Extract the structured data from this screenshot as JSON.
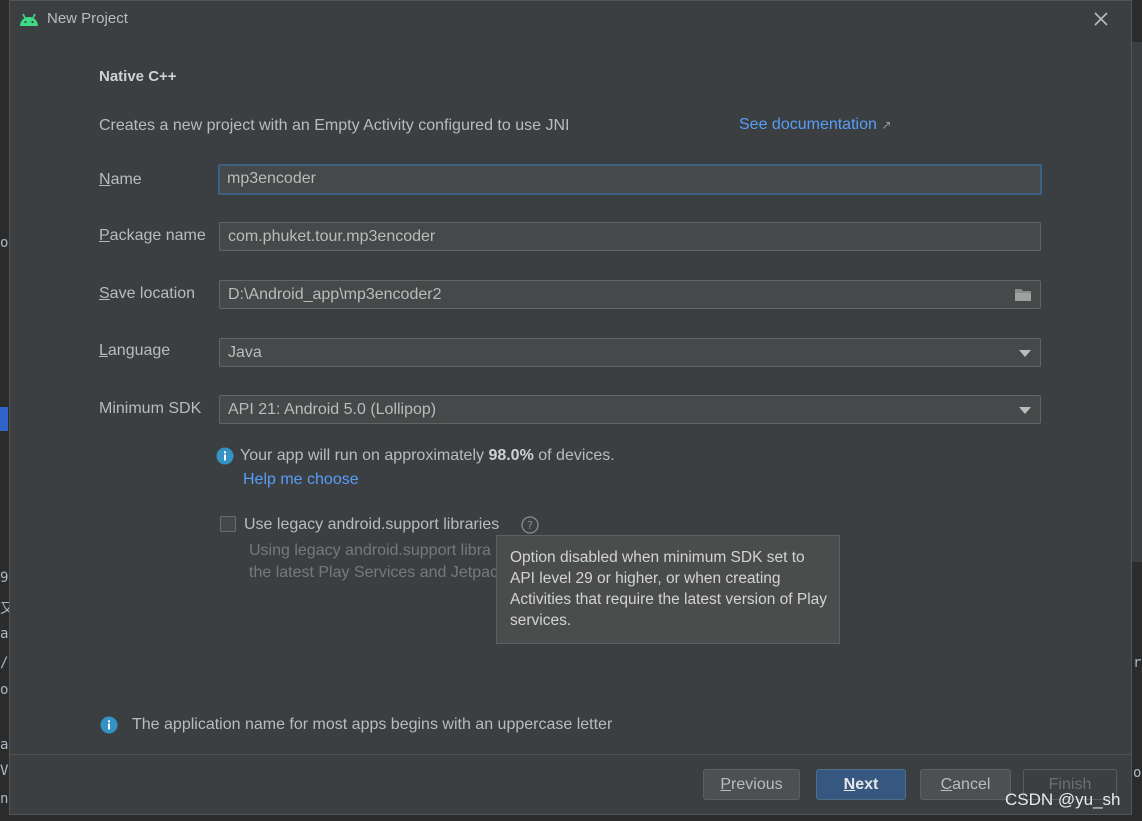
{
  "window": {
    "title": "New Project"
  },
  "template": {
    "heading": "Native C++",
    "description": "Creates a new project with an Empty Activity configured to use JNI",
    "doc_link": "See documentation",
    "doc_link_icon": "↗"
  },
  "form": {
    "name": {
      "label_mnemonic": "N",
      "label_rest": "ame",
      "value": "mp3encoder"
    },
    "package": {
      "label_mnemonic": "P",
      "label_rest": "ackage name",
      "value": "com.phuket.tour.mp3encoder"
    },
    "save_location": {
      "label_mnemonic": "S",
      "label_rest": "ave location",
      "value": "D:\\Android_app\\mp3encoder2"
    },
    "language": {
      "label_mnemonic": "L",
      "label_rest": "anguage",
      "value": "Java"
    },
    "min_sdk": {
      "label": "Minimum SDK",
      "value": "API 21: Android 5.0 (Lollipop)"
    }
  },
  "sdk_info": {
    "prefix": "Your app will run on approximately ",
    "percent": "98.0%",
    "suffix": " of devices.",
    "help_link": "Help me choose"
  },
  "legacy": {
    "label": "Use legacy android.support libraries",
    "checked": false,
    "desc_line1": "Using legacy android.support libra",
    "desc_line2": "the latest Play Services and Jetpac"
  },
  "tooltip": {
    "text": "Option disabled when minimum SDK set to API level 29 or higher, or when creating Activities that require the latest version of Play services."
  },
  "validation": {
    "message": "The application name for most apps begins with an uppercase letter"
  },
  "buttons": {
    "previous_mnemonic": "P",
    "previous_rest": "revious",
    "next_mnemonic": "N",
    "next_rest": "ext",
    "cancel_mnemonic": "C",
    "cancel_rest": "ancel",
    "finish": "Finish"
  },
  "watermark": "CSDN @yu_sh",
  "background_fragments": {
    "f1": "o",
    "f2": "9",
    "f3": "又",
    "f4": "ai",
    "f5": "/",
    "f6": "op",
    "f7": "ai",
    "f8": "V",
    "f9": "na",
    "f10": "r",
    "f11": "o"
  },
  "colors": {
    "accent": "#589df6",
    "primary_button": "#365880",
    "dialog_bg": "#3c3f41",
    "info_icon": "#3592c4"
  },
  "icons": [
    "android-icon",
    "close-icon",
    "external-link-icon",
    "folder-icon",
    "chevron-down-icon",
    "info-icon",
    "help-icon"
  ]
}
